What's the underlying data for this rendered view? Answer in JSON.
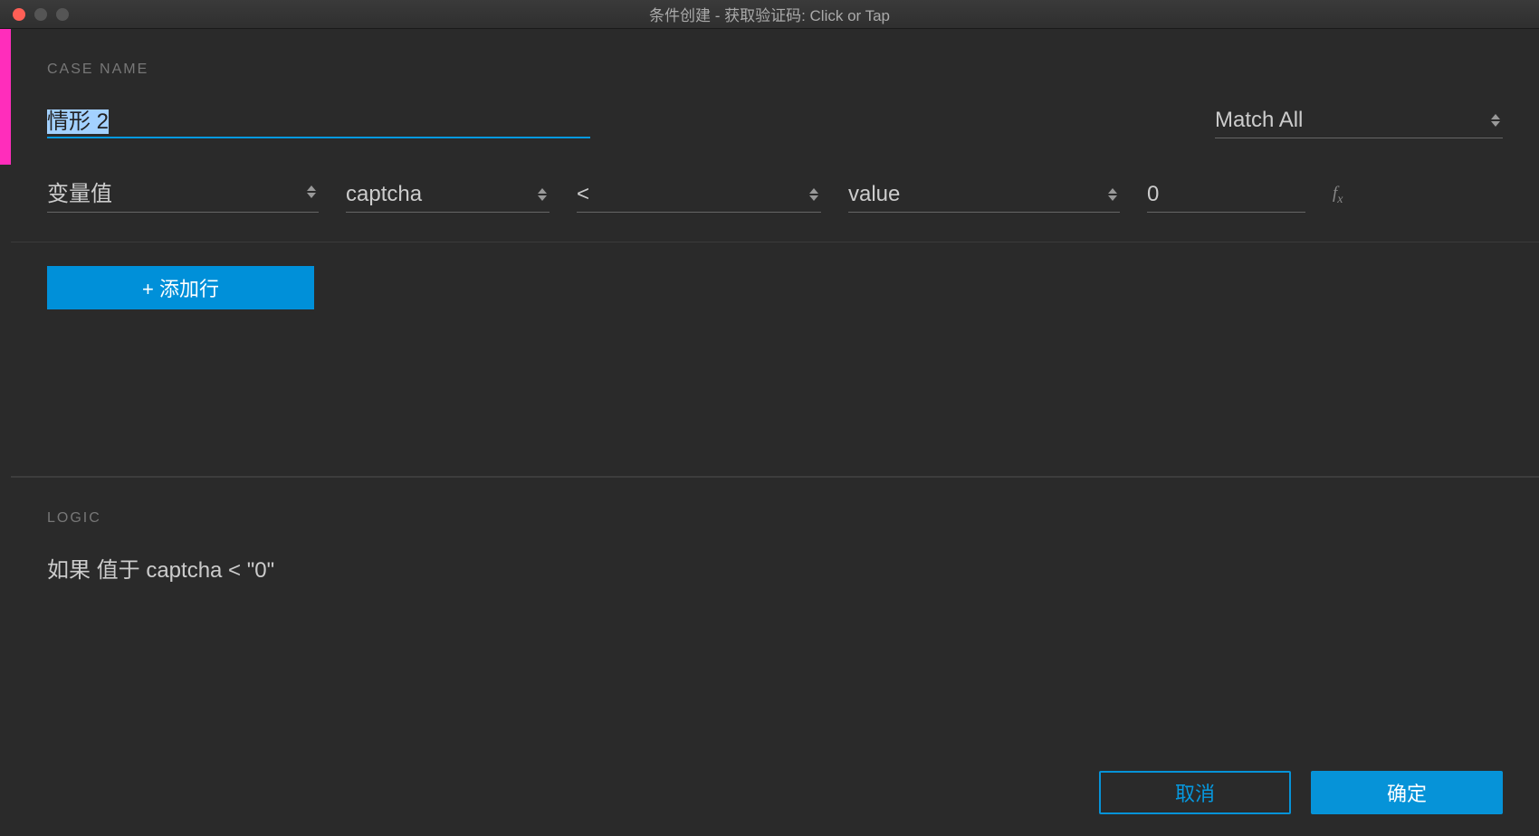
{
  "window": {
    "title": "条件创建   -   获取验证码: Click or Tap"
  },
  "labels": {
    "case_name": "CASE NAME",
    "logic": "LOGIC"
  },
  "case": {
    "name_value": "情形 2",
    "match_mode": "Match All"
  },
  "condition": {
    "field1": "变量值",
    "field2": "captcha",
    "operator": "<",
    "field4": "value",
    "value": "0"
  },
  "buttons": {
    "add_row": "+ 添加行",
    "cancel": "取消",
    "ok": "确定"
  },
  "logic": {
    "expression": "如果 值于 captcha < \"0\""
  }
}
